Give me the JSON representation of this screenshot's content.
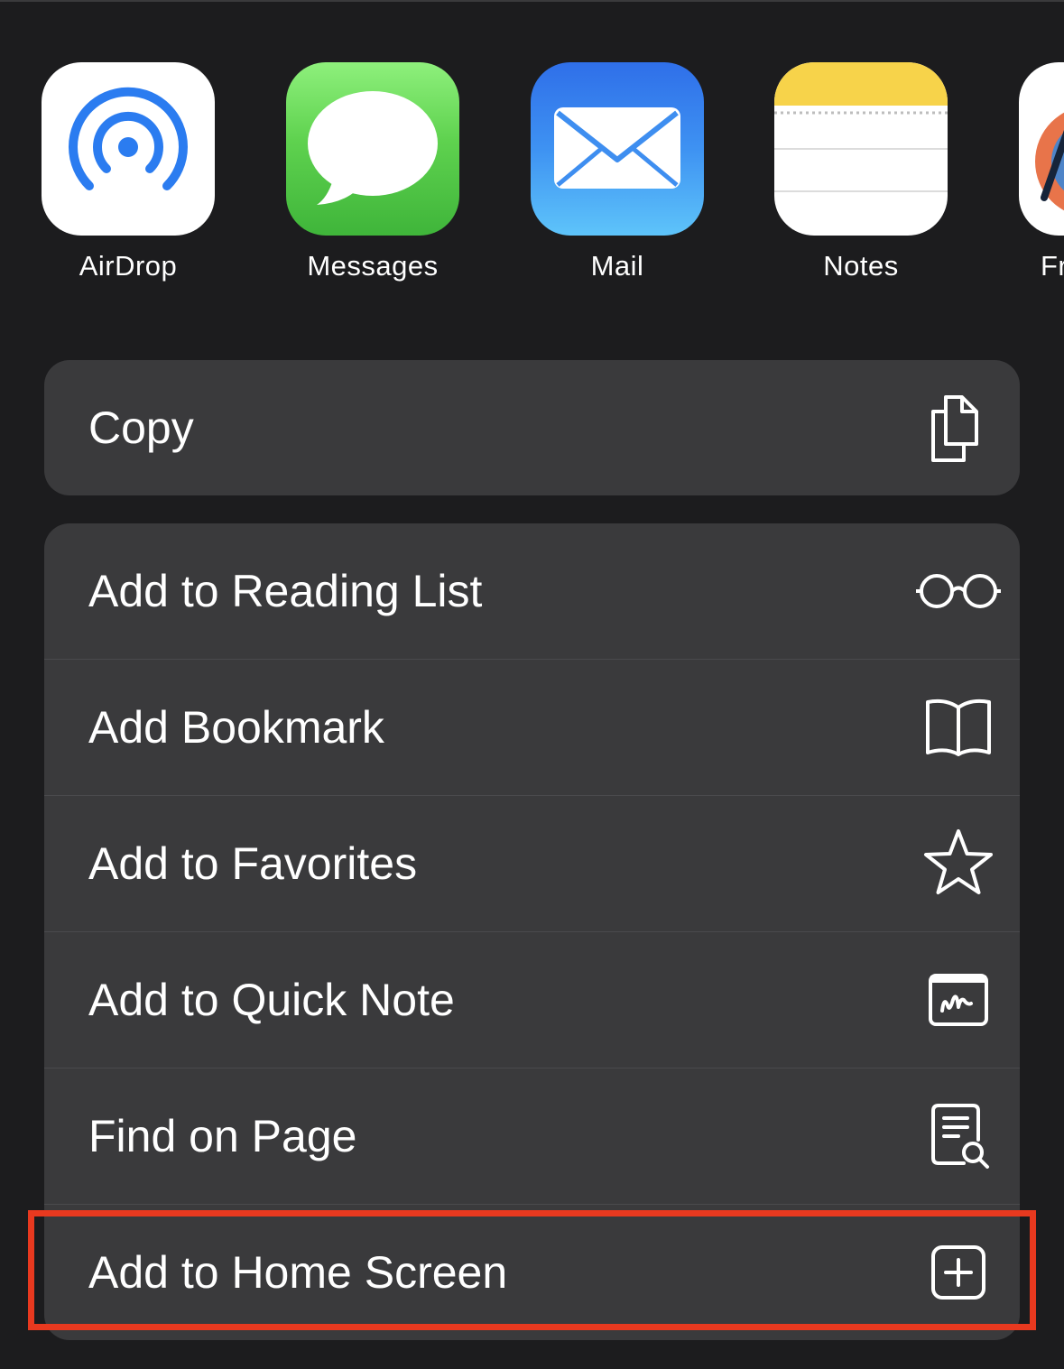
{
  "share_sheet": {
    "apps": [
      {
        "label": "AirDrop",
        "icon": "airdrop-icon"
      },
      {
        "label": "Messages",
        "icon": "messages-icon"
      },
      {
        "label": "Mail",
        "icon": "mail-icon"
      },
      {
        "label": "Notes",
        "icon": "notes-icon"
      },
      {
        "label": "Fr",
        "icon": "partial-app-icon"
      }
    ],
    "copy": {
      "label": "Copy",
      "icon": "copy-icon"
    },
    "actions": [
      {
        "label": "Add to Reading List",
        "icon": "glasses-icon"
      },
      {
        "label": "Add Bookmark",
        "icon": "book-icon"
      },
      {
        "label": "Add to Favorites",
        "icon": "star-icon"
      },
      {
        "label": "Add to Quick Note",
        "icon": "quick-note-icon"
      },
      {
        "label": "Find on Page",
        "icon": "find-on-page-icon"
      },
      {
        "label": "Add to Home Screen",
        "icon": "plus-square-icon"
      }
    ]
  },
  "colors": {
    "background": "#1c1c1e",
    "row_background": "#3a3a3c",
    "highlight": "#e8391f",
    "airdrop_blue": "#2b7cf0"
  }
}
